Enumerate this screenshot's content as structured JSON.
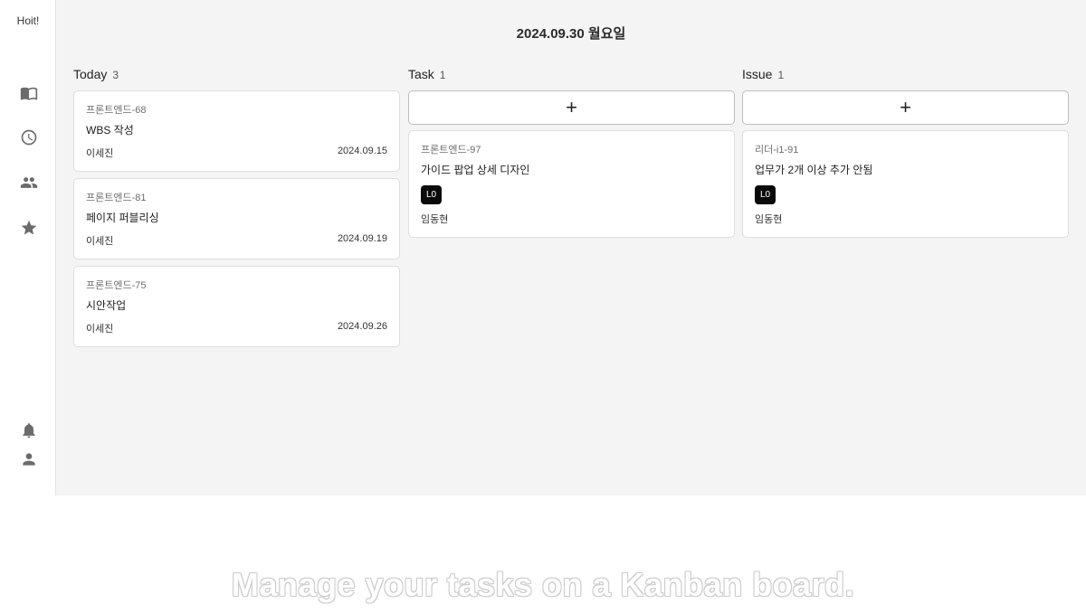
{
  "app": {
    "logo": "Hoit!"
  },
  "sidebar": {
    "icons": [
      "book-open-icon",
      "clock-icon",
      "people-icon",
      "star-icon",
      "bell-icon",
      "person-icon"
    ]
  },
  "header": {
    "date": "2024.09.30 월요일"
  },
  "columns": [
    {
      "title": "Today",
      "count": "3",
      "cards": [
        {
          "key": "프론트엔드-68",
          "title": "WBS 작성",
          "assignee": "이세진",
          "date": "2024.09.15"
        },
        {
          "key": "프론트엔드-81",
          "title": "페이지 퍼블리싱",
          "assignee": "이세진",
          "date": "2024.09.19"
        },
        {
          "key": "프론트엔드-75",
          "title": "시안작업",
          "assignee": "이세진",
          "date": "2024.09.26"
        }
      ]
    },
    {
      "title": "Task",
      "count": "1",
      "add_label": "+",
      "cards": [
        {
          "key": "프론트엔드-97",
          "title": "가이드 팝업 상세 디자인",
          "badge": "L0",
          "assignee": "임동현"
        }
      ]
    },
    {
      "title": "Issue",
      "count": "1",
      "add_label": "+",
      "cards": [
        {
          "key": "리더-i1-91",
          "title": "업무가 2개 이상 추가 안됨",
          "badge": "L0",
          "assignee": "임동현"
        }
      ]
    }
  ],
  "caption": "Manage your tasks on a Kanban board.",
  "colors": {
    "background": "#f4f4f4",
    "card": "#ffffff",
    "badge": "#0a0a0a"
  }
}
